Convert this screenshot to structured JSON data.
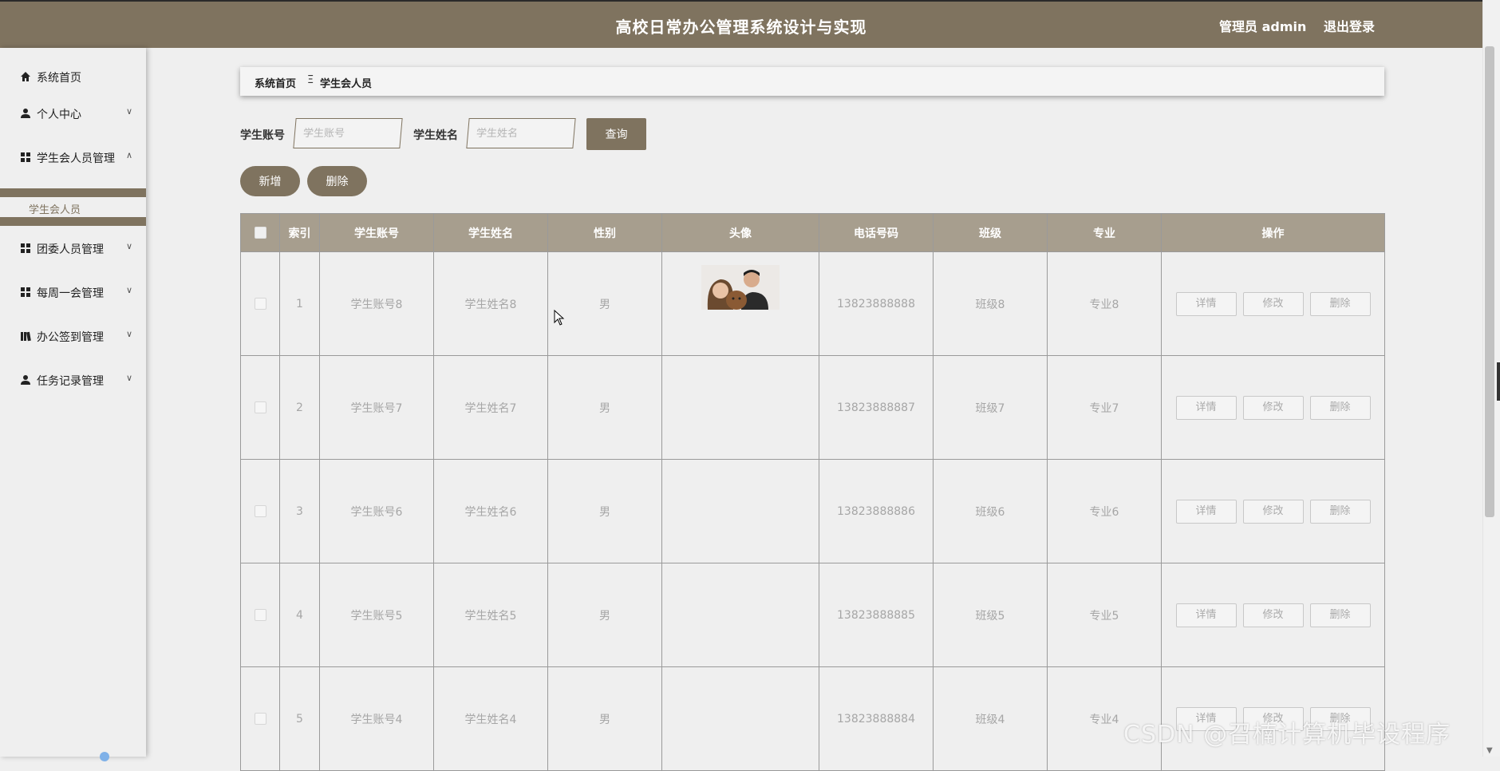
{
  "header": {
    "title": "高校日常办公管理系统设计与实现",
    "admin_label": "管理员 admin",
    "logout_label": "退出登录"
  },
  "sidebar": {
    "items": [
      {
        "label": "系统首页",
        "icon": "home-icon"
      },
      {
        "label": "个人中心",
        "icon": "user-icon"
      },
      {
        "label": "学生会人员管理",
        "icon": "grid-icon"
      },
      {
        "label": "团委人员管理",
        "icon": "grid-icon"
      },
      {
        "label": "每周一会管理",
        "icon": "grid-icon"
      },
      {
        "label": "办公签到管理",
        "icon": "library-icon"
      },
      {
        "label": "任务记录管理",
        "icon": "user-icon"
      }
    ],
    "submenu_label": "学生会人员"
  },
  "breadcrumb": {
    "home": "系统首页",
    "separator": "Ξ",
    "current": "学生会人员"
  },
  "search": {
    "account_label": "学生账号",
    "account_placeholder": "学生账号",
    "name_label": "学生姓名",
    "name_placeholder": "学生姓名",
    "query_label": "查询"
  },
  "actions": {
    "add_label": "新增",
    "delete_label": "删除"
  },
  "table": {
    "headers": [
      "索引",
      "学生账号",
      "学生姓名",
      "性别",
      "头像",
      "电话号码",
      "班级",
      "专业",
      "操作"
    ],
    "rows": [
      {
        "index": "1",
        "account": "学生账号8",
        "name": "学生姓名8",
        "gender": "男",
        "phone": "13823888888",
        "class": "班级8",
        "major": "专业8"
      },
      {
        "index": "2",
        "account": "学生账号7",
        "name": "学生姓名7",
        "gender": "男",
        "phone": "13823888887",
        "class": "班级7",
        "major": "专业7"
      },
      {
        "index": "3",
        "account": "学生账号6",
        "name": "学生姓名6",
        "gender": "男",
        "phone": "13823888886",
        "class": "班级6",
        "major": "专业6"
      },
      {
        "index": "4",
        "account": "学生账号5",
        "name": "学生姓名5",
        "gender": "男",
        "phone": "13823888885",
        "class": "班级5",
        "major": "专业5"
      },
      {
        "index": "5",
        "account": "学生账号4",
        "name": "学生姓名4",
        "gender": "男",
        "phone": "13823888884",
        "class": "班级4",
        "major": "专业4"
      }
    ],
    "row_actions": {
      "detail": "详情",
      "edit": "修改",
      "delete": "删除"
    }
  },
  "watermark": "CSDN @召楠计算机毕设程序",
  "colors": {
    "accent": "#7f735f",
    "table_header": "#a79e8e",
    "background": "#efefef"
  }
}
